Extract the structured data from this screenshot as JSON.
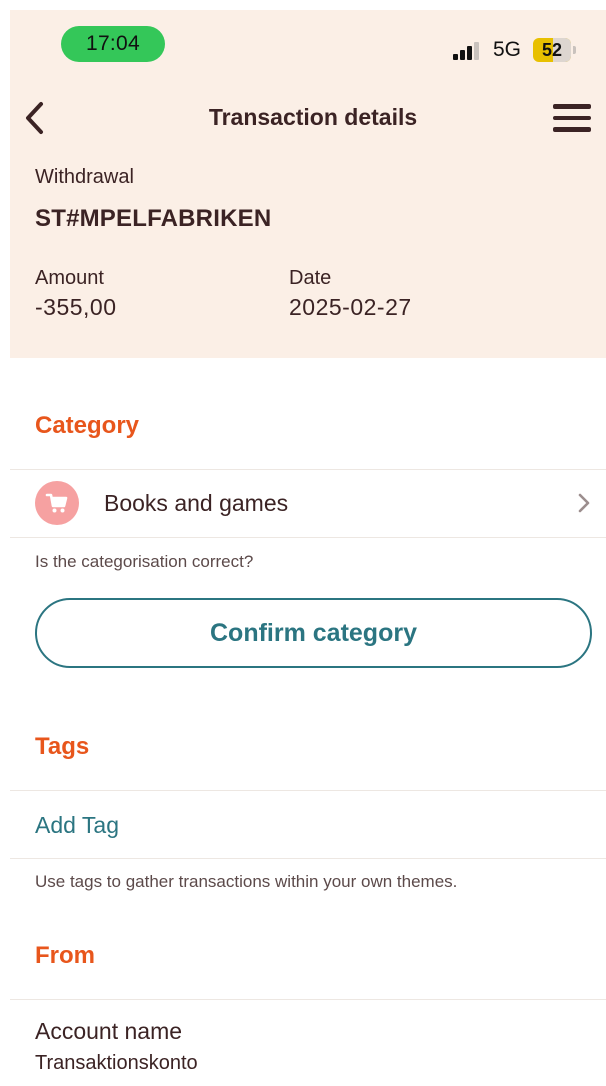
{
  "status_bar": {
    "time": "17:04",
    "network": "5G",
    "battery": "52",
    "battery_level_percent": 52
  },
  "nav": {
    "back_icon": "chevron-left-icon",
    "title": "Transaction details",
    "menu_icon": "hamburger-menu-icon"
  },
  "transaction": {
    "type": "Withdrawal",
    "merchant": "ST#MPELFABRIKEN",
    "amount_label": "Amount",
    "amount": "-355,00",
    "date_label": "Date",
    "date": "2025-02-27"
  },
  "category": {
    "section_title": "Category",
    "icon": "shopping-cart-icon",
    "name": "Books and games",
    "question": "Is the categorisation correct?",
    "confirm_label": "Confirm category"
  },
  "tags": {
    "section_title": "Tags",
    "add_label": "Add Tag",
    "hint": "Use tags to gather transactions within your own themes."
  },
  "from": {
    "section_title": "From",
    "account_name_label": "Account name",
    "account_name": "Transaktionskonto"
  },
  "colors": {
    "header_background": "#fbefe6",
    "section_title": "#e8561c",
    "accent_teal": "#2b7581",
    "text": "#3b2324",
    "category_icon_bg": "#f6a1a1",
    "time_pill": "#34c759",
    "battery": "#e8c000"
  }
}
